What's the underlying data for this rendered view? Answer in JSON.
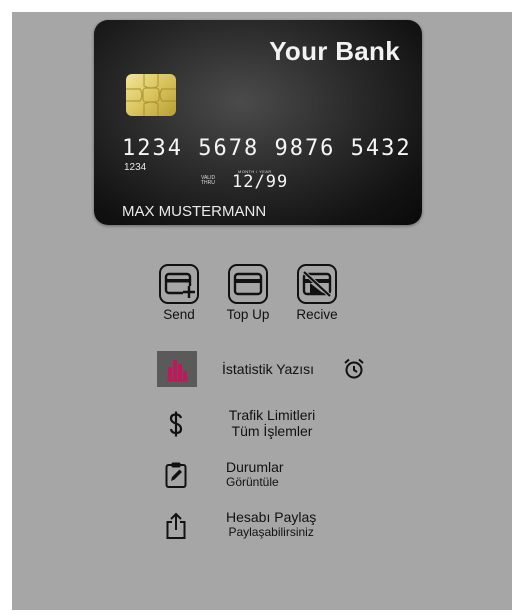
{
  "card": {
    "bank_name": "Your Bank",
    "number": "1234 5678 9876 5432",
    "number_small": "1234",
    "valid_thru_label": "VALID THRU",
    "month_year_label": "MONTH / YEAR",
    "expiry": "12/99",
    "holder": "MAX MUSTERMANN"
  },
  "actions": [
    {
      "label": "Send",
      "icon": "card-add-icon"
    },
    {
      "label": "Top Up",
      "icon": "credit-card-icon"
    },
    {
      "label": "Recive",
      "icon": "card-off-icon"
    }
  ],
  "menu": {
    "statistics": {
      "label": "İstatistik Yazısı",
      "icon": "bar-chart-icon",
      "alarm_icon": "alarm-clock-icon"
    },
    "traffic": {
      "line1": "Trafik Limitleri",
      "line2": "Tüm İşlemler",
      "icon": "dollar-icon"
    },
    "status": {
      "line1": "Durumlar",
      "line2": "Görüntüle",
      "icon": "clipboard-edit-icon"
    },
    "share": {
      "line1": "Hesabı Paylaş",
      "line2": "Paylaşabilirsiniz",
      "icon": "share-icon"
    }
  },
  "colors": {
    "panel_bg": "#a6a6a6",
    "chart_icon_bg": "#5a5a5a",
    "chart_icon_fg": "#c2185b"
  }
}
